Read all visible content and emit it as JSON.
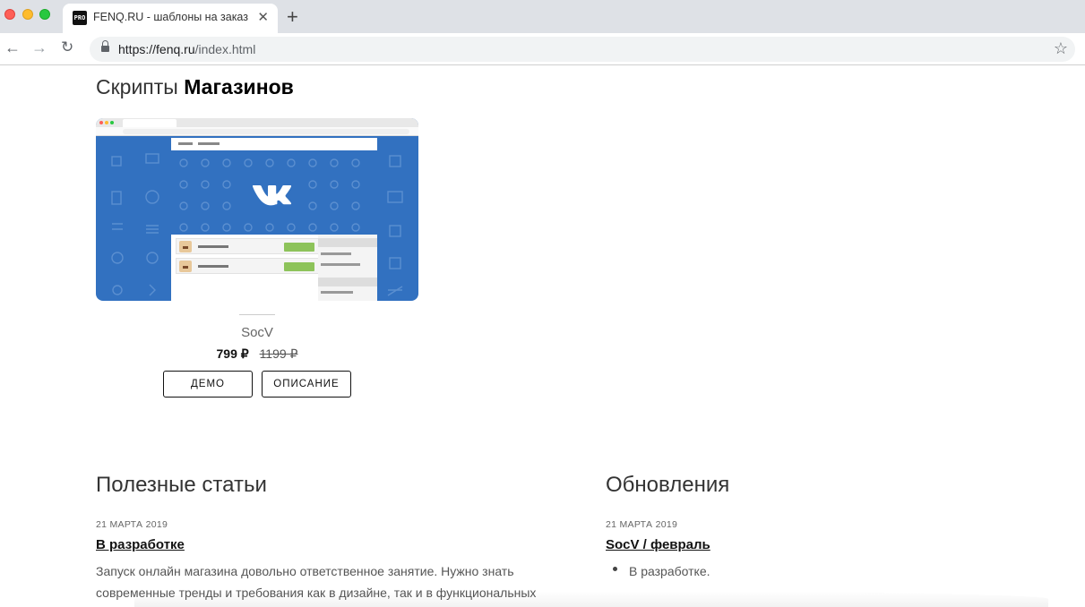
{
  "browser": {
    "tab_title": "FENQ.RU - шаблоны на заказ",
    "favicon_text": "PRO",
    "url_host": "https://fenq.ru",
    "url_path": "/index.html"
  },
  "section": {
    "title_light": "Скрипты",
    "title_bold": "Магазинов"
  },
  "product": {
    "name": "SocV",
    "price_new": "799 ₽",
    "price_old": "1199 ₽",
    "demo_label": "ДЕМО",
    "description_label": "ОПИСАНИЕ"
  },
  "articles": {
    "title": "Полезные статьи",
    "date": "21 МАРТА 2019",
    "link": "В разработке",
    "text_line1": "Запуск онлайн магазина довольно ответственное занятие. Нужно знать",
    "text_line2": "современные тренды и требования как в дизайне, так и в функциональных"
  },
  "updates": {
    "title": "Обновления",
    "date": "21 МАРТА 2019",
    "link": "SocV / февраль",
    "items": [
      "В разработке."
    ]
  },
  "colors": {
    "product_bg": "#3271c0",
    "price_badge": "#8dc35a"
  }
}
